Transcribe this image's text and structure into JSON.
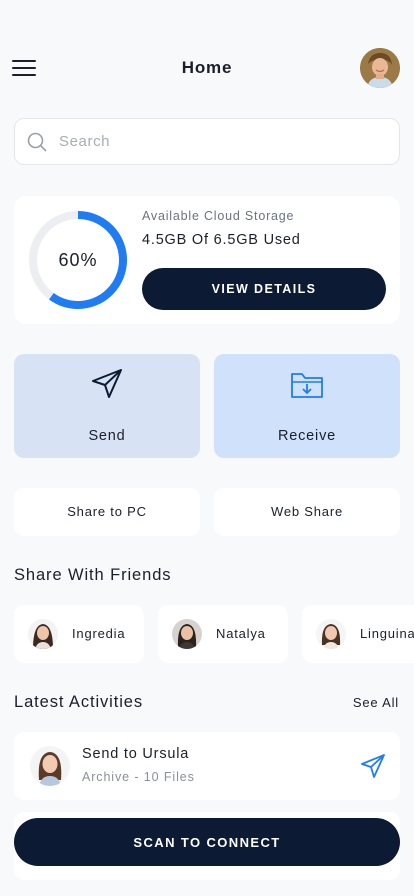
{
  "header": {
    "title": "Home",
    "menu_icon": "hamburger-menu-icon",
    "avatar_icon": "user-avatar"
  },
  "search": {
    "placeholder": "Search",
    "value": "",
    "icon": "search-icon"
  },
  "storage": {
    "percent_label": "60%",
    "percent_value": 0.6,
    "title": "Available Cloud Storage",
    "used_text": "4.5GB Of 6.5GB Used",
    "button_label": "VIEW DETAILS",
    "ring_color": "#1f7cf2",
    "track_color": "#eceef1"
  },
  "actions": {
    "send": {
      "label": "Send",
      "icon": "paper-plane-icon"
    },
    "receive": {
      "label": "Receive",
      "icon": "folder-download-icon"
    }
  },
  "share": {
    "pc_label": "Share to PC",
    "web_label": "Web Share"
  },
  "friends": {
    "title": "Share With Friends",
    "items": [
      {
        "name": "Ingredia"
      },
      {
        "name": "Natalya"
      },
      {
        "name": "Linguina"
      }
    ]
  },
  "activities": {
    "title": "Latest Activities",
    "see_all": "See All",
    "items": [
      {
        "title": "Send to Ursula",
        "subtitle": "Archive - 10 Files",
        "icon": "paper-plane-icon"
      }
    ]
  },
  "scan_button_label": "SCAN TO CONNECT",
  "colors": {
    "accent": "#1f7cf2",
    "dark": "#0c1a33",
    "send_tile": "#d7e3f4",
    "receive_tile": "#cfe1fb"
  }
}
